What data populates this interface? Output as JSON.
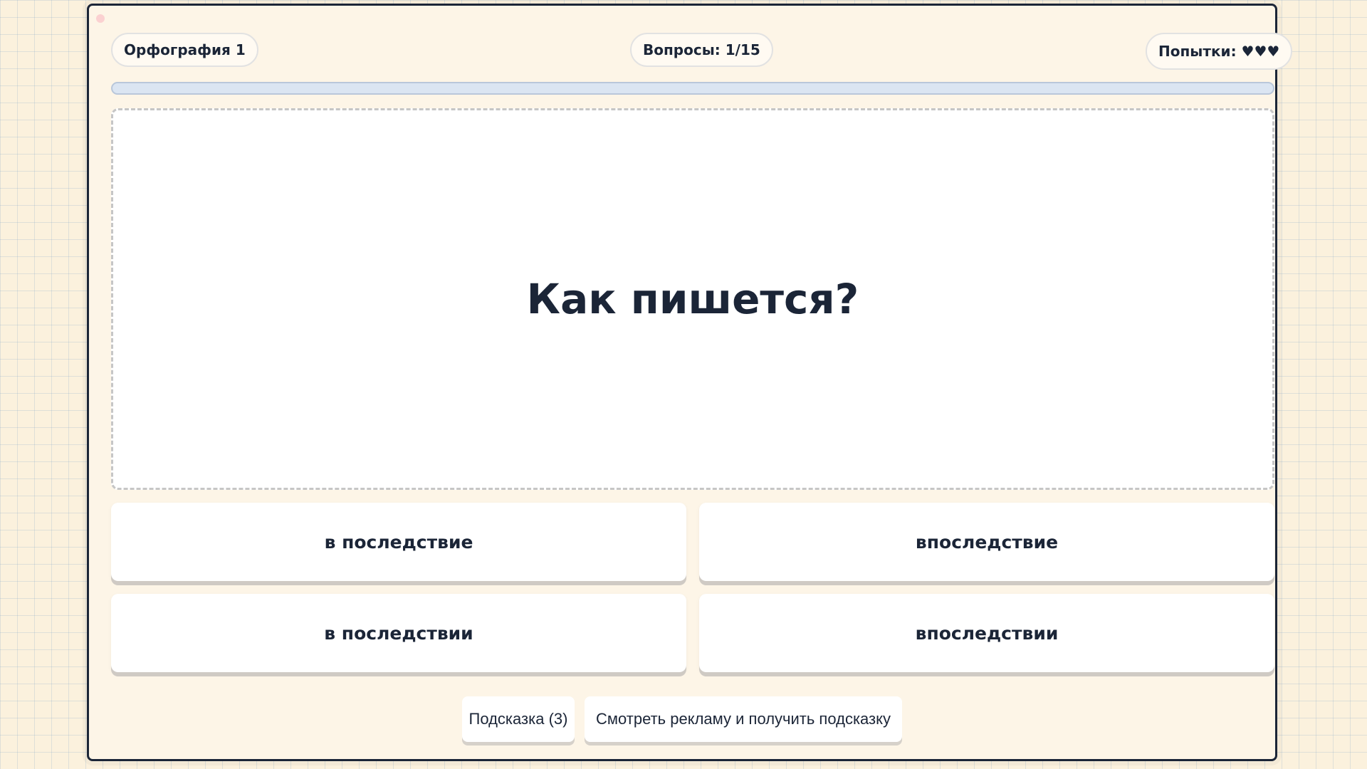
{
  "header": {
    "level_label": "Орфография 1",
    "questions_label": "Вопросы: 1/15",
    "attempts_label": "Попытки: ♥♥♥"
  },
  "progress": {
    "fraction": 0
  },
  "question": {
    "text": "Как пишется?"
  },
  "answers": [
    {
      "label": "в последствие"
    },
    {
      "label": "впоследствие"
    },
    {
      "label": "в последствии"
    },
    {
      "label": "впоследствии"
    }
  ],
  "footer": {
    "hint_label": "Подсказка (3)",
    "ad_hint_label": "Смотреть рекламу и получить подсказку"
  },
  "colors": {
    "accent_dark": "#1b2537",
    "background": "#fbf1dd",
    "card": "#fdf5e7",
    "progress_track": "#dbe5f2"
  }
}
